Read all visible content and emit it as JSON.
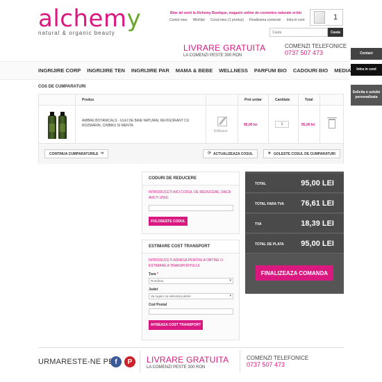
{
  "logo": {
    "main": "alchem",
    "leaf": "y",
    "tagline": "natural & organic beauty"
  },
  "header": {
    "welcome": "Bine ati venit la Alchemy Boutique, magazin online de cosmetice naturale si bio",
    "links": [
      "Contul meu",
      "Wishlist",
      "Cosul meu (1 produs)",
      "Finalizarea comenzii",
      "Intra in cont"
    ],
    "cart_count": "1",
    "search_placeholder": "Cauta",
    "search_button": "Cauta"
  },
  "promo": {
    "title": "LIVRARE GRATUITA",
    "subtitle": "LA COMENZI PESTE 300 RON"
  },
  "phone": {
    "label": "COMENZI TELEFONICE",
    "number": "0737 507 473"
  },
  "side_tabs": {
    "contact": "Contact",
    "login": "Intra in cont",
    "help": "Solicita o solutie personalizata"
  },
  "nav": [
    "INGRIJIRE CORP",
    "INGRIJIRE TEN",
    "INGRIJIRE PAR",
    "MAMA & BEBE",
    "WELLNESS",
    "PARFUM BIO",
    "CADOURI BIO",
    "MEDIA"
  ],
  "page_title": "COS DE CUMPARATURI",
  "cart": {
    "headers": {
      "product": "Produs",
      "unit_price": "Pret unitar",
      "quantity": "Cantitate",
      "total": "Total"
    },
    "item": {
      "name": "AMBRE BOTANICALS - ULEI DE BAIE NATURAL REVIGORANT CU ROZMARIN, CIMBRU SI MENTA",
      "edit_label": "Editeaza",
      "unit_price": "95,00 lei",
      "quantity": "1",
      "total": "95,00 lei"
    },
    "continue_button": "CONTINUA CUMPARATURILE",
    "update_button": "ACTUALIZEAZA COSUL",
    "empty_button": "GOLESTE COSUL DE CUMPARATURI"
  },
  "discount": {
    "title": "CODURI DE REDUCERE",
    "description": "INTRODUCETI AICI CODUL DE REDUCERE, DACA AVETI UNUL",
    "button": "FOLOSESTE CODUL"
  },
  "shipping": {
    "title": "ESTIMARE COST TRANSPORT",
    "description": "INTRODUCETI ADRESA PENTRU A OBTINE O ESTIMARE A TRANSPORTULUI.",
    "country_label": "Țara",
    "country_required": "*",
    "country_value": "România",
    "county_label": "Judet",
    "county_value": "Va rugam sa selectati judetul",
    "postal_label": "Cod Postal",
    "button": "AFISEAZA COST TRANSPORT"
  },
  "totals": {
    "rows": [
      {
        "label": "TOTAL",
        "value": "95,00 LEI"
      },
      {
        "label": "TOTAL FARA TVA",
        "value": "76,61 LEI"
      },
      {
        "label": "TVA",
        "value": "18,39 LEI"
      },
      {
        "label": "TOTAL DE PLATA",
        "value": "95,00 LEI"
      }
    ],
    "finalize_button": "FINALIZEAZA COMANDA"
  },
  "footer": {
    "follow": "URMARESTE-NE PE:",
    "promo_title": "LIVRARE GRATUITA",
    "promo_subtitle": "LA COMENZI PESTE 300 RON",
    "phone_label": "COMENZI TELEFONICE",
    "phone_number": "0737 507 473"
  },
  "colors": {
    "brand_pink": "#d9197f",
    "leaf_green": "#6aa72a",
    "totals_bg": "#555555"
  }
}
